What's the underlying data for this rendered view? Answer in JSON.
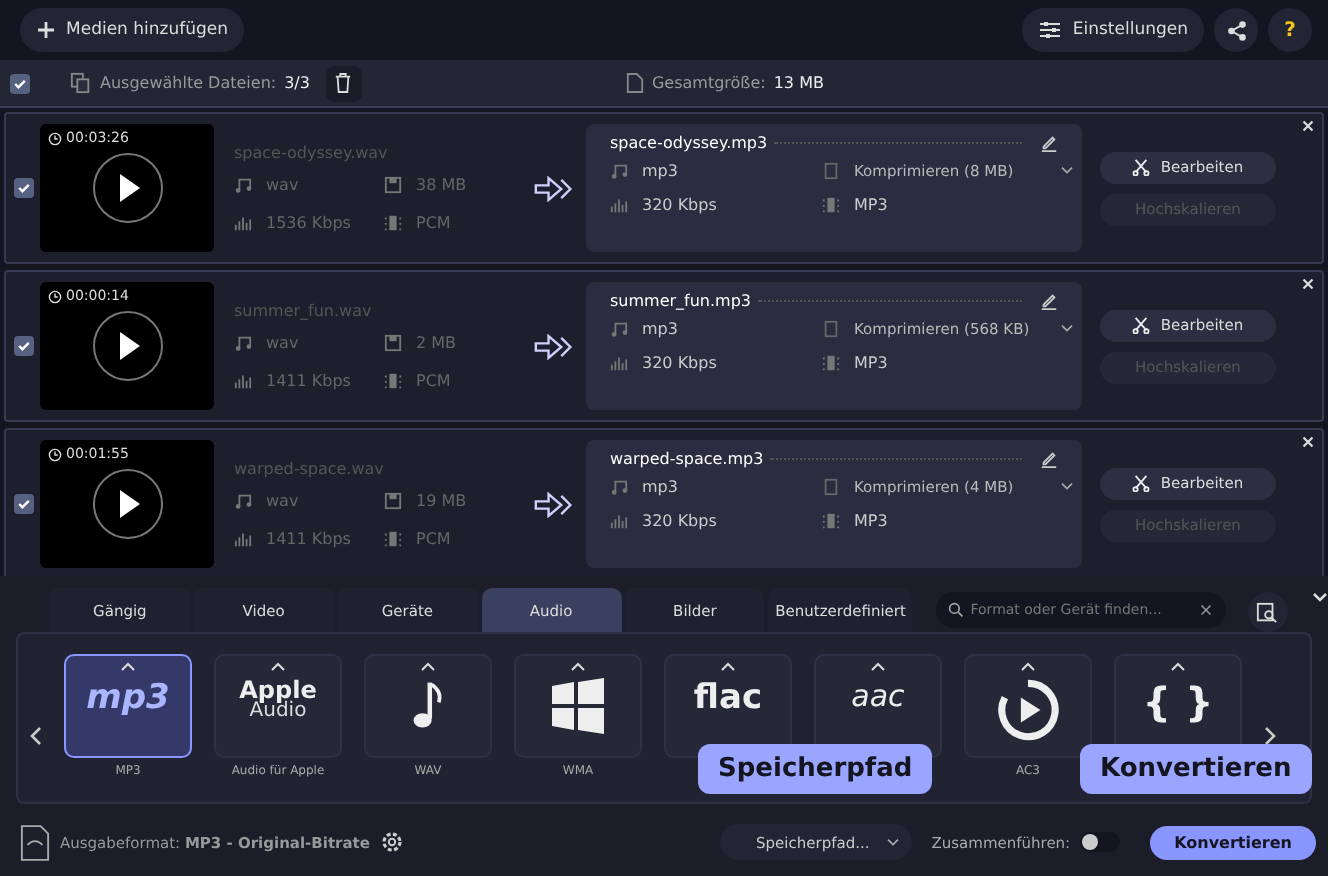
{
  "toolbar": {
    "add_button": "Medien hinzufügen",
    "settings_button": "Einstellungen",
    "help_button": "?"
  },
  "selection_bar": {
    "checked": true,
    "selected_label": "Ausgewählte Dateien:",
    "selected_count": "3/3",
    "total_label": "Gesamtgröße:",
    "total_value": "13 MB"
  },
  "files": [
    {
      "checked": true,
      "duration": "00:03:26",
      "source": {
        "name": "space-odyssey.wav",
        "format": "wav",
        "size": "38 MB",
        "bitrate": "1536 Kbps",
        "codec": "PCM"
      },
      "output": {
        "name": "space-odyssey.mp3",
        "format": "mp3",
        "compression": "Komprimieren (8 MB)",
        "bitrate": "320 Kbps",
        "codec": "MP3"
      },
      "edit_button": "Bearbeiten",
      "upscale_button": {
        "label": "Hochskalieren",
        "disabled": true
      }
    },
    {
      "checked": true,
      "duration": "00:00:14",
      "source": {
        "name": "summer_fun.wav",
        "format": "wav",
        "size": "2 MB",
        "bitrate": "1411 Kbps",
        "codec": "PCM"
      },
      "output": {
        "name": "summer_fun.mp3",
        "format": "mp3",
        "compression": "Komprimieren (568 KB)",
        "bitrate": "320 Kbps",
        "codec": "MP3"
      },
      "edit_button": "Bearbeiten",
      "upscale_button": {
        "label": "Hochskalieren",
        "disabled": true
      }
    },
    {
      "checked": true,
      "duration": "00:01:55",
      "source": {
        "name": "warped-space.wav",
        "format": "wav",
        "size": "19 MB",
        "bitrate": "1411 Kbps",
        "codec": "PCM"
      },
      "output": {
        "name": "warped-space.mp3",
        "format": "mp3",
        "compression": "Komprimieren (4 MB)",
        "bitrate": "320 Kbps",
        "codec": "MP3"
      },
      "edit_button": "Bearbeiten",
      "upscale_button": {
        "label": "Hochskalieren",
        "disabled": true
      }
    }
  ],
  "format_tabs": [
    {
      "label": "Gängig",
      "selected": false
    },
    {
      "label": "Video",
      "selected": false
    },
    {
      "label": "Geräte",
      "selected": false
    },
    {
      "label": "Audio",
      "selected": true
    },
    {
      "label": "Bilder",
      "selected": false
    },
    {
      "label": "Benutzerdefiniert",
      "selected": false
    }
  ],
  "format_search": {
    "placeholder": "Format oder Gerät finden..."
  },
  "formats": [
    {
      "kind": "mp3",
      "logo_text": "mp3",
      "label": "MP3",
      "selected": true
    },
    {
      "kind": "apple",
      "logo_text": "Apple",
      "logo_subtext": "Audio",
      "label": "Audio für Apple",
      "selected": false
    },
    {
      "kind": "note",
      "label": "WAV",
      "selected": false
    },
    {
      "kind": "windows",
      "label": "WMA",
      "selected": false
    },
    {
      "kind": "flac",
      "logo_text": "flac",
      "selected": false
    },
    {
      "kind": "aac",
      "logo_text": "aac",
      "selected": false
    },
    {
      "kind": "play",
      "label": "AC3",
      "selected": false
    },
    {
      "kind": "braces",
      "logo_text": "{ }",
      "selected": false
    }
  ],
  "bottom_bar": {
    "output_format": "Ausgabeformat: **MP3 - Original-Bitrate**",
    "save_path": "Speicherpfad...",
    "merge_label": "Zusammenführen:",
    "merge_on": false,
    "convert_button": "Konvertieren"
  },
  "tooltips": [
    {
      "kind": "save_path",
      "text": "Speicherpfad"
    },
    {
      "kind": "convert",
      "text": "Konvertieren"
    }
  ]
}
